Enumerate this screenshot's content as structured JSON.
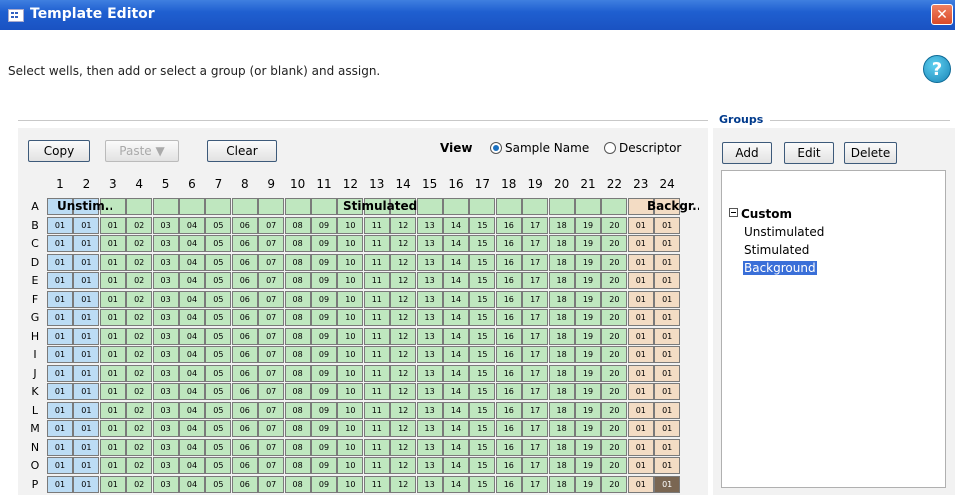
{
  "window": {
    "title": "Template Editor",
    "close_glyph": "✕"
  },
  "instructions": "Select wells, then add or select a group (or blank) and assign.",
  "help_glyph": "?",
  "toolbar": {
    "copy_label": "Copy",
    "paste_label": "Paste ▼",
    "clear_label": "Clear"
  },
  "view": {
    "label": "View",
    "options": [
      "Sample Name",
      "Descriptor"
    ],
    "selected": "Sample Name"
  },
  "plate": {
    "columns": [
      "1",
      "2",
      "3",
      "4",
      "5",
      "6",
      "7",
      "8",
      "9",
      "10",
      "11",
      "12",
      "13",
      "14",
      "15",
      "16",
      "17",
      "18",
      "19",
      "20",
      "21",
      "22",
      "23",
      "24"
    ],
    "rows": [
      "A",
      "B",
      "C",
      "D",
      "E",
      "F",
      "G",
      "H",
      "I",
      "J",
      "K",
      "L",
      "M",
      "N",
      "O",
      "P"
    ],
    "well_labels": [
      "01",
      "01",
      "01",
      "02",
      "03",
      "04",
      "05",
      "06",
      "07",
      "08",
      "09",
      "10",
      "11",
      "12",
      "13",
      "14",
      "15",
      "16",
      "17",
      "18",
      "19",
      "20",
      "01",
      "01"
    ],
    "group_names": {
      "unstimulated": "Unstim...",
      "stimulated": "Stimulated",
      "background": "Backgr..."
    },
    "colors": {
      "unstimulated": "#bcdcf4",
      "stimulated": "#bfe7bf",
      "background": "#f3dcc4",
      "selected_well": "#7a6652"
    }
  },
  "groups": {
    "title": "Groups",
    "add_label": "Add",
    "edit_label": "Edit",
    "delete_label": "Delete",
    "tree": {
      "root": "Custom",
      "items": [
        "Unstimulated",
        "Stimulated",
        "Background"
      ],
      "selected": "Background"
    }
  }
}
